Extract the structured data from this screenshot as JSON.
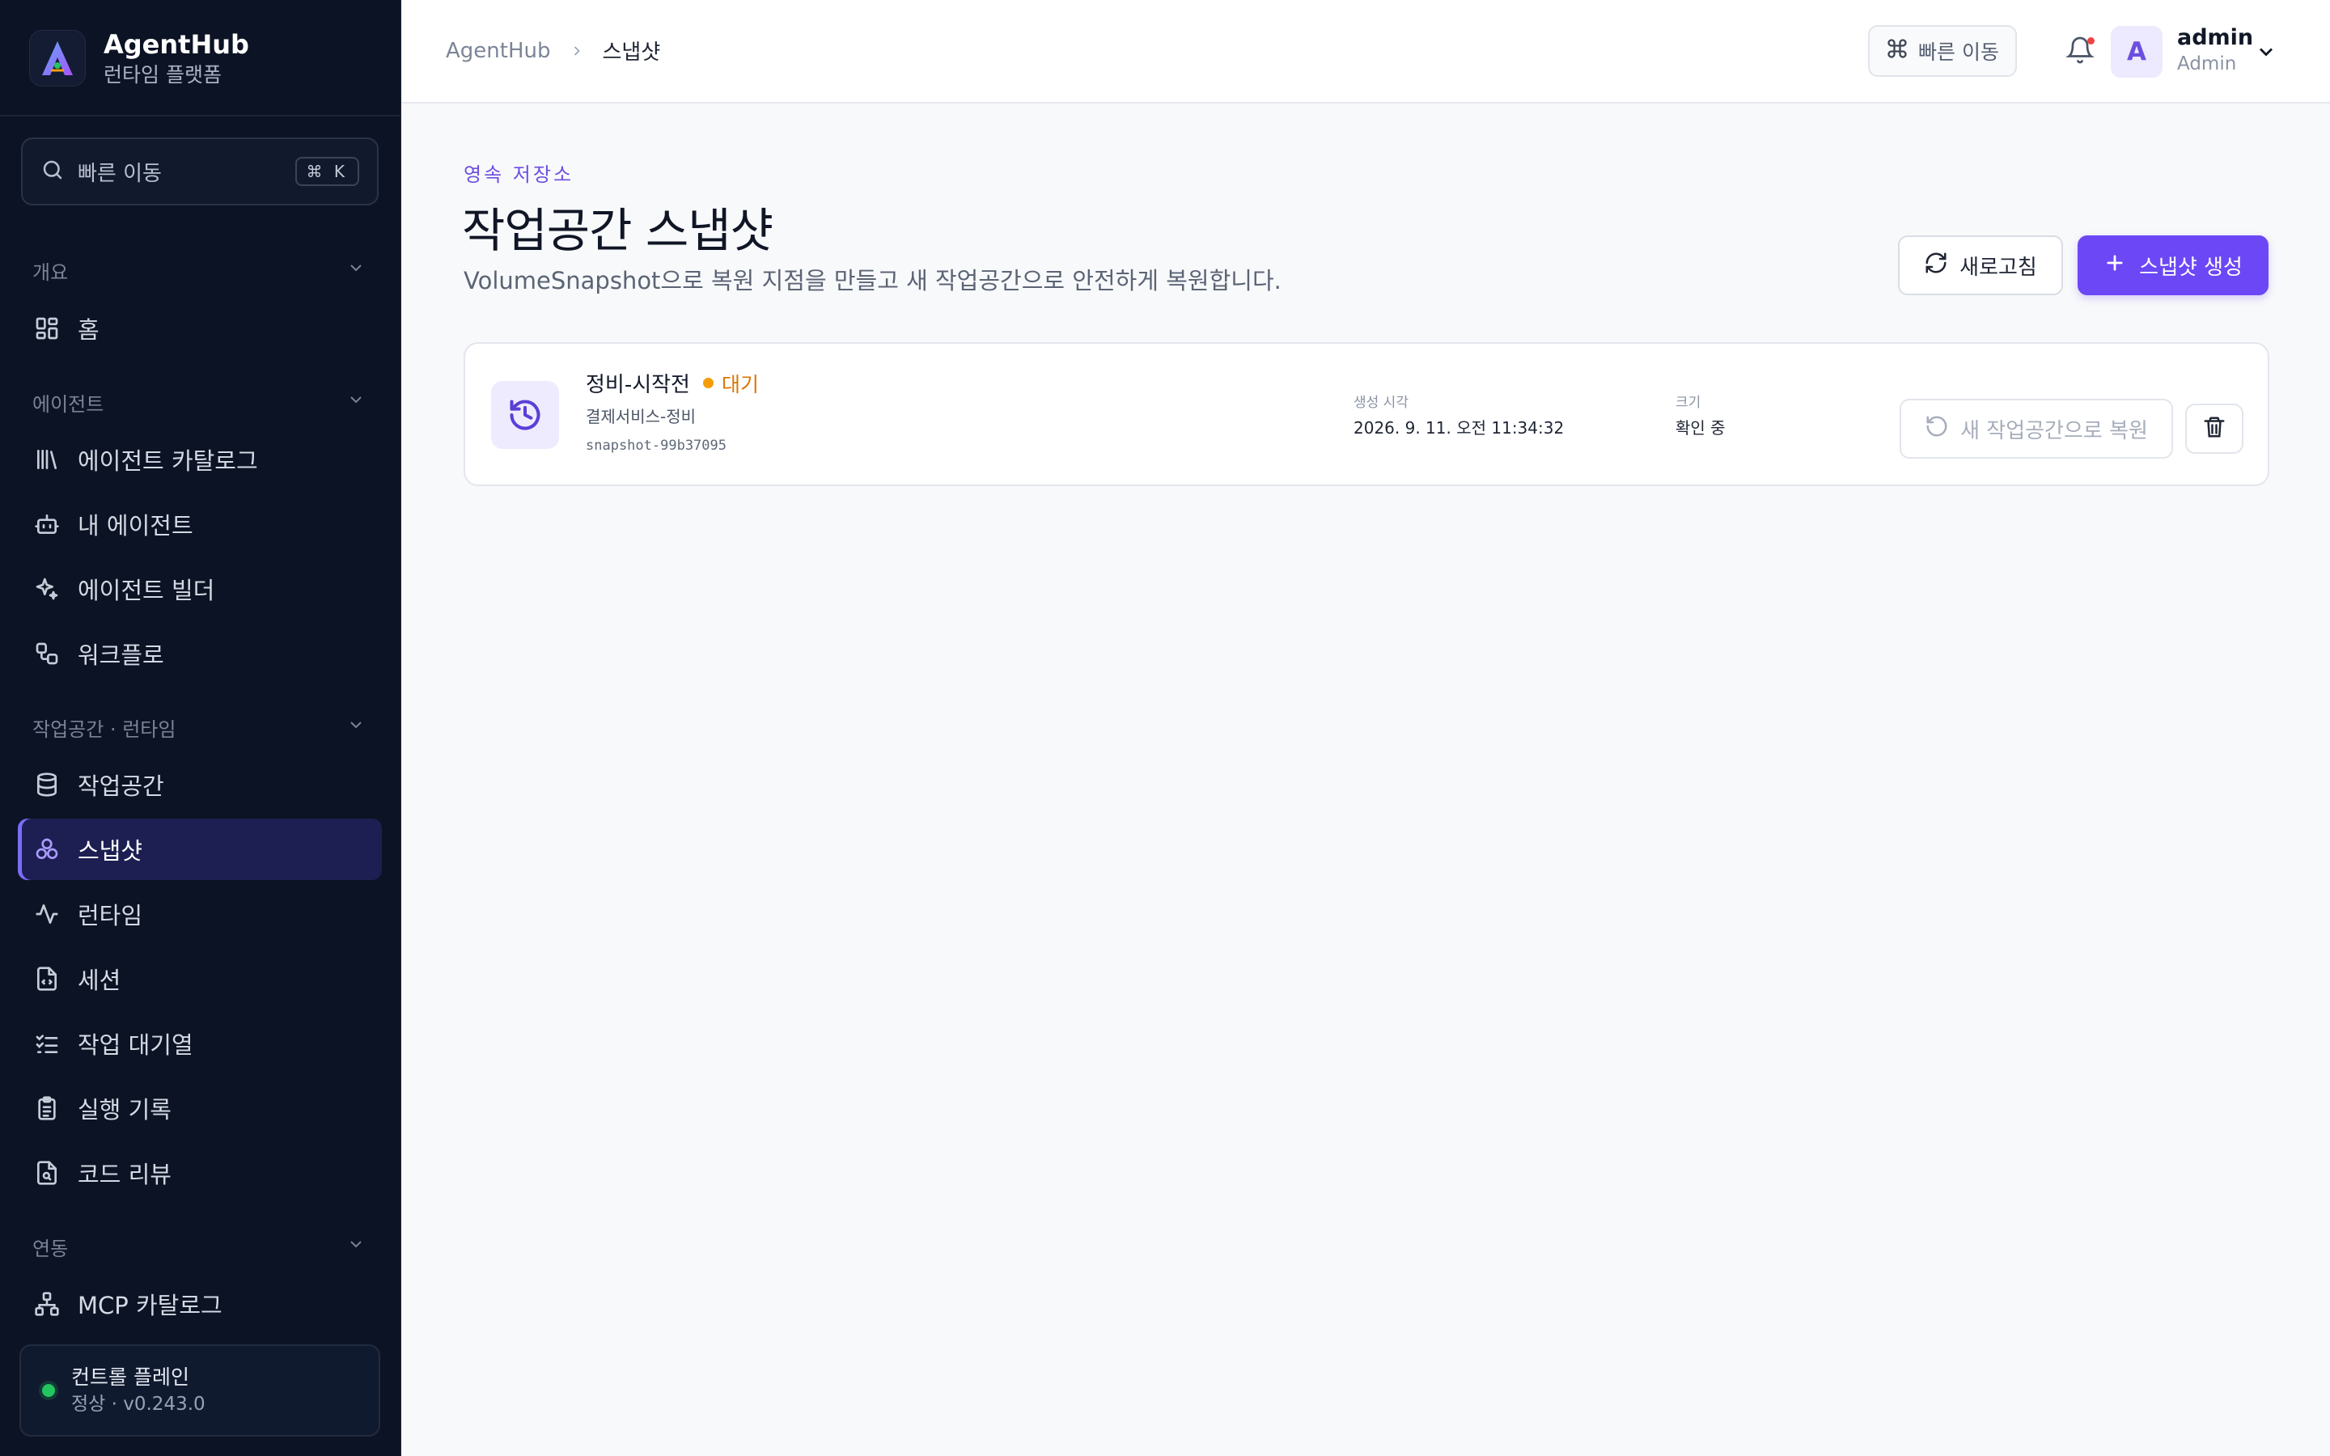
{
  "app": {
    "name": "AgentHub",
    "subtitle": "런타임 플랫폼"
  },
  "sidebar": {
    "search_placeholder": "빠른 이동",
    "search_shortcut": "⌘ K",
    "sections": [
      {
        "label": "개요",
        "items": [
          {
            "label": "홈",
            "icon": "dashboard-icon"
          }
        ]
      },
      {
        "label": "에이전트",
        "items": [
          {
            "label": "에이전트 카탈로그",
            "icon": "library-icon"
          },
          {
            "label": "내 에이전트",
            "icon": "bot-icon"
          },
          {
            "label": "에이전트 빌더",
            "icon": "sparkles-icon"
          },
          {
            "label": "워크플로",
            "icon": "workflow-icon"
          }
        ]
      },
      {
        "label": "작업공간 · 런타임",
        "items": [
          {
            "label": "작업공간",
            "icon": "database-icon"
          },
          {
            "label": "스냅샷",
            "icon": "boxes-icon",
            "active": true
          },
          {
            "label": "런타임",
            "icon": "activity-icon"
          },
          {
            "label": "세션",
            "icon": "file-code-icon"
          },
          {
            "label": "작업 대기열",
            "icon": "list-checks-icon"
          },
          {
            "label": "실행 기록",
            "icon": "clipboard-icon"
          },
          {
            "label": "코드 리뷰",
            "icon": "file-search-icon"
          }
        ]
      },
      {
        "label": "연동",
        "items": [
          {
            "label": "MCP 카탈로그",
            "icon": "network-icon"
          }
        ]
      }
    ],
    "control_plane": {
      "title": "컨트롤 플레인",
      "status": "정상 · v0.243.0",
      "status_color": "#22c55e"
    }
  },
  "topbar": {
    "breadcrumb_root": "AgentHub",
    "breadcrumb_current": "스냅샷",
    "quick_nav_label": "빠른 이동",
    "user": {
      "initial": "A",
      "name": "admin",
      "role": "Admin"
    }
  },
  "page": {
    "eyebrow": "영속 저장소",
    "title": "작업공간 스냅샷",
    "description": "VolumeSnapshot으로 복원 지점을 만들고 새 작업공간으로 안전하게 복원합니다.",
    "refresh_label": "새로고침",
    "create_label": "스냅샷 생성",
    "accent_color": "#6c47f5"
  },
  "snapshots": [
    {
      "name": "정비-시작전",
      "status": "대기",
      "status_color": "#f59e0b",
      "workspace": "결제서비스-정비",
      "id": "snapshot-99b37095",
      "created_label": "생성 시각",
      "created_value": "2026. 9. 11. 오전 11:34:32",
      "size_label": "크기",
      "size_value": "확인 중",
      "restore_label": "새 작업공간으로 복원"
    }
  ]
}
